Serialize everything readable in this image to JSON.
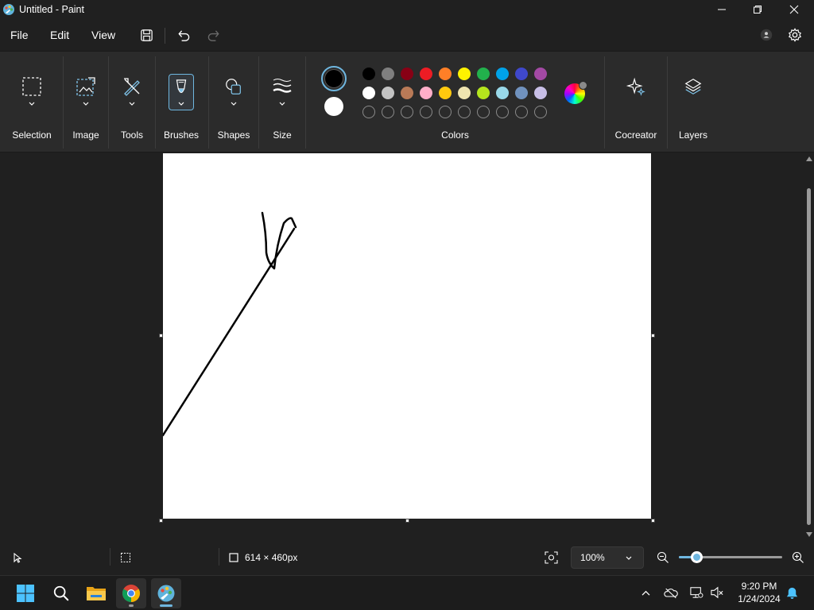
{
  "window": {
    "title": "Untitled - Paint"
  },
  "menu": {
    "file": "File",
    "edit": "Edit",
    "view": "View"
  },
  "ribbon": {
    "groups": {
      "selection": "Selection",
      "image": "Image",
      "tools": "Tools",
      "brushes": "Brushes",
      "shapes": "Shapes",
      "size": "Size",
      "colors": "Colors",
      "cocreator": "Cocreator",
      "layers": "Layers"
    },
    "primary_color": "#000000",
    "secondary_color": "#ffffff",
    "palette_row1": [
      "#000000",
      "#7f7f7f",
      "#880015",
      "#ed1c24",
      "#ff7f27",
      "#fff200",
      "#22b14c",
      "#00a2e8",
      "#3f48cc",
      "#a349a4"
    ],
    "palette_row2": [
      "#ffffff",
      "#c3c3c3",
      "#b97a57",
      "#ffaec9",
      "#ffc90e",
      "#efe4b0",
      "#b5e61d",
      "#99d9ea",
      "#7092be",
      "#c8bfe7"
    ],
    "palette_row3_empty_slots": 10
  },
  "canvas": {
    "background": "#ffffff"
  },
  "status": {
    "canvas_size": "614 × 460px",
    "zoom": "100%",
    "zoom_slider_fraction": 0.17
  },
  "taskbar": {
    "time": "9:20 PM",
    "date": "1/24/2024"
  },
  "theme": {
    "accent": "#6fb7e0"
  }
}
